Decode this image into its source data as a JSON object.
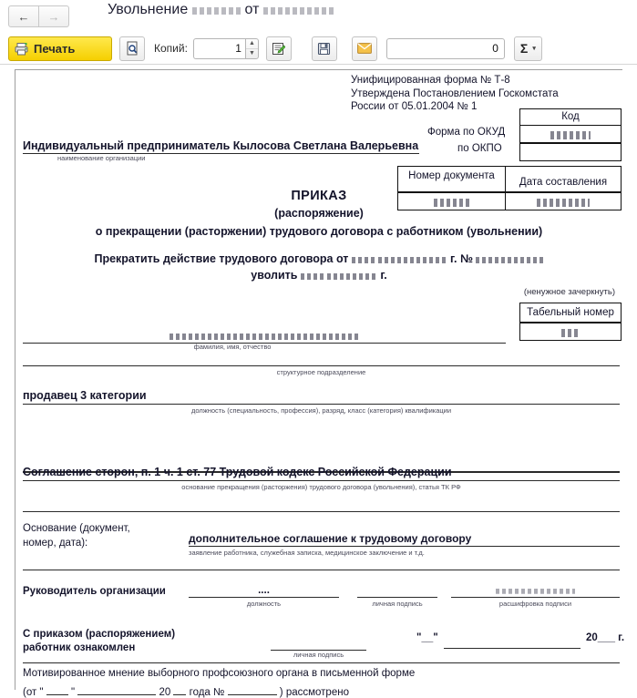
{
  "window": {
    "title_prefix": "Увольнение",
    "title_number": "070505",
    "title_mid": "от",
    "title_date": "07.05.2025",
    "nav_back": "←",
    "nav_forward": "→"
  },
  "toolbar": {
    "print_label": "Печать",
    "preview_name": "preview-icon",
    "copies_label": "Копий:",
    "copies_value": "1",
    "spin_up": "▲",
    "spin_down": "▼",
    "edit_name": "edit-document-icon",
    "save_name": "save-icon",
    "mail_name": "email-icon",
    "sum_value": "0",
    "sigma_label": "Σ",
    "sigma_caret": "▾"
  },
  "document": {
    "form_meta": [
      "Унифицированная форма № Т-8",
      "Утверждена Постановлением Госкомстата",
      "России от 05.01.2004 № 1"
    ],
    "code_table": {
      "header": "Код",
      "okud_label": "Форма по ОКУД",
      "okud_value": "0301006",
      "okpo_label": "по ОКПО",
      "okpo_value": ""
    },
    "organization": {
      "name": "Индивидуальный предприниматель Кылосова Светлана Валерьевна",
      "caption": "наименование организации"
    },
    "number_date_table": {
      "col1_header": "Номер документа",
      "col2_header": "Дата составления",
      "col1_value": "070505",
      "col2_value": "07.05.2025"
    },
    "title": {
      "main": "ПРИКАЗ",
      "sub1": "(распоряжение)",
      "sub2": "о прекращении (расторжении) трудового договора с работником (увольнении)"
    },
    "terminate": {
      "prefix": "Прекратить действие трудового договора от",
      "quote_day": "\"01\"",
      "date_rest": "января 2020",
      "year_mark": "г.",
      "num_label": "№",
      "contract_no": "КСВ0000002",
      "dismiss_label": "уволить",
      "dismiss_quote_day": "\"07\"",
      "dismiss_date": "мая 2025",
      "dismiss_year_mark": "г.",
      "strike_note": "(ненужное зачеркнуть)"
    },
    "tabel": {
      "header": "Табельный номер",
      "value": "221"
    },
    "employee": {
      "fio": "С.Эрлыковой Елены Анатольевны",
      "caption": "фамилия, имя, отчество"
    },
    "subdivision": {
      "value": "",
      "caption": "структурное подразделение"
    },
    "position": {
      "value": "продавец 3 категории",
      "caption": "должность (специальность, профессия), разряд, класс (категория) квалификации"
    },
    "grounds": {
      "value": "Соглашение сторон, п. 1 ч. 1 ст. 77 Трудовой кодекс Российской Федерации",
      "caption": "основание прекращения (расторжения) трудового договора (увольнения), статья ТК РФ"
    },
    "basis": {
      "label_line1": "Основание (документ,",
      "label_line2": "номер, дата):",
      "value": "дополнительное соглашение к трудовому договору",
      "caption": "заявление работника, служебная записка, медицинское заключение и т.д."
    },
    "signatures": {
      "head_label": "Руководитель организации",
      "head_position": "....",
      "cap_position": "должность",
      "cap_signature": "личная подпись",
      "head_name": "С. В. Кылосова",
      "cap_decode": "расшифровка подписи",
      "ack_line1": "С приказом (распоряжением)",
      "ack_line2": "работник ознакомлен",
      "ack_cap": "личная подпись",
      "ack_quote": "\"__\"",
      "ack_year": "20___ г."
    },
    "union": {
      "line1": "Мотивированное мнение выборного профсоюзного органа в письменной форме",
      "line2_a": "(от \"",
      "line2_b": "\"",
      "line2_c": "20",
      "line2_d": "года",
      "line2_e": "№",
      "line2_f": ") рассмотрено"
    }
  }
}
